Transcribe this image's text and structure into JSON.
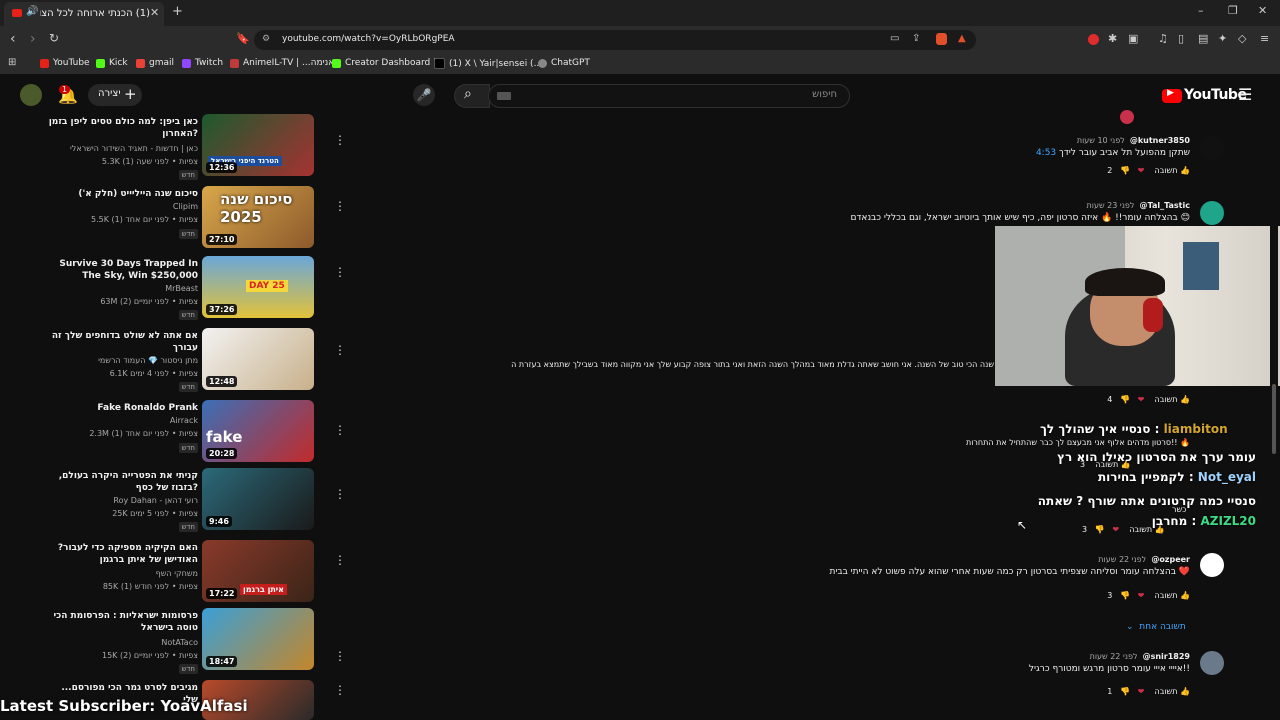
{
  "browser": {
    "tab_title": "(1) הכנתי ארוחה לכל הצופים",
    "url": "youtube.com/watch?v=OyRLbORgPEA",
    "bookmarks": [
      "YouTube",
      "Kick",
      "gmail",
      "Twitch",
      "AnimeIL-TV | ...אנימה",
      "Creator Dashboard |...",
      "(1) X \\ Yair|sensei (...",
      "ChatGPT"
    ]
  },
  "youtube": {
    "logo": "YouTube",
    "search_placeholder": "חיפוש",
    "create_label": "יצירה",
    "notif_count": "1"
  },
  "videos": [
    {
      "title": "כאן ביפן: למה כולם טסים ליפן בזמן האחרון?",
      "channel": "כאן | חדשות - תאגיד השידור הישראלי",
      "meta": "5.3K צפיות • לפני שעה (1)",
      "badge": "חדש",
      "duration": "12:36",
      "thumb_text": "הטרנד היפני בישראל"
    },
    {
      "title": "סיכום שנה הייליייט (חלק א')",
      "channel": "Clipim",
      "meta": "5.5K צפיות • לפני יום אחד (1)",
      "badge": "חדש",
      "duration": "27:10",
      "thumb_text": "סיכום שנה 2025"
    },
    {
      "title": "Survive 30 Days Trapped In The Sky, Win $250,000",
      "channel": "MrBeast",
      "meta": "63M צפיות • לפני יומיים (2)",
      "badge": "חדש",
      "duration": "37:26",
      "thumb_text": "DAY 25"
    },
    {
      "title": "אם אתה לא שולט בדוחפים שלך זה עבורך",
      "channel": "מתן ניסטור 💎 העמוד הרשמי",
      "meta": "6.1K צפיות • לפני 4 ימים",
      "badge": "חדש",
      "duration": "12:48",
      "thumb_text": ""
    },
    {
      "title": "Fake Ronaldo Prank",
      "channel": "Airrack",
      "meta": "2.3M צפיות • לפני יום אחד (1)",
      "badge": "חדש",
      "duration": "20:28",
      "thumb_text": "fake"
    },
    {
      "title": "קניתי את הפטרייה היקרה בעולם, בזבוז של כסף?",
      "channel": "Roy Dahan - רועי דהאן",
      "meta": "25K צפיות • לפני 5 ימים",
      "badge": "חדש",
      "duration": "9:46",
      "thumb_text": ""
    },
    {
      "title": "האם הקיקיה מספיקה כדי לעבור? האודישן של איתן ברגמן",
      "channel": "משחקי השף",
      "meta": "85K צפיות • לפני חודש (1)",
      "badge": "",
      "duration": "17:22",
      "thumb_text": "איתן ברגמן"
    },
    {
      "title": "פרסומות ישראליות : הפרסומת הכי טוסה בישראל",
      "channel": "NotATaco",
      "meta": "15K צפיות • לפני יומיים (2)",
      "badge": "חדש",
      "duration": "18:47",
      "thumb_text": ""
    },
    {
      "title": "...מגיבים לסרט גמר הכי מפורסם שלי",
      "channel": "",
      "meta": "",
      "badge": "",
      "duration": "",
      "thumb_text": ""
    }
  ],
  "comments": [
    {
      "user": "@kutner3850",
      "time": "לפני 10 שעות",
      "text": "שתקן מהפועל תל אביב עובר לידך",
      "timestamp": "4:53",
      "likes": "2",
      "reply": "תשובה"
    },
    {
      "user": "@Tal_Tastic",
      "time": "לפני 23 שעות",
      "text": "בהצלחה עומר!! 🔥 איזה סרטון יפה, כיף שיש אותך ביוטיוב ישראל, וגם בכללי כבנאדם 😊",
      "likes": "4",
      "reply": "תשובה"
    },
    {
      "user": "",
      "time": "",
      "text": "שנה הכי טוב של השנה. אני חושב שאתה גדלת מאוד במהלך השנה הזאת ואני בתור צופה קבוע שלך אני מקווה מאוד בשבילך שתמצא בעזרת ה",
      "likes": "",
      "reply": ""
    },
    {
      "user": "",
      "time": "",
      "text": "סרטון מדהים אלוף אני מבעצם לך כבר שהתחיל את התחרות!! 🔥",
      "likes": "3",
      "reply": "תשובה"
    },
    {
      "user": "",
      "time": "",
      "text": "כשר",
      "likes": "3",
      "reply": "תשובה"
    },
    {
      "user": "@ozpeer",
      "time": "לפני 22 שעות",
      "text": "בהצלחה עומר וסליחה שצפיתי בסרטון רק כמה שעות אחרי שהוא עלה פשוט לא הייתי בבית ❤️",
      "likes": "3",
      "reply": "תשובה",
      "more_replies": "תשובה אחת"
    },
    {
      "user": "@snir1829",
      "time": "לפני 22 שעות",
      "text": "איייי אייי עומר סרטון מרגש ומטורף כרגיל!!",
      "likes": "1",
      "reply": "תשובה"
    }
  ],
  "stream_chat": [
    {
      "user": "liambiton",
      "text": "סנסיי איך שהולך לך",
      "color": "#d4a72c"
    },
    {
      "user": "Not_eyal",
      "text": "עומר ערך את הסרטון כאילו הוא רץ לקמפיין בחירות",
      "color": "#9fd3ff"
    },
    {
      "user": "AZIZL20",
      "text": "סנסיי כמה קרטונים אתה שורף ? שאתה מחרבן",
      "color": "#3ddc84"
    }
  ],
  "overlay": {
    "latest_subscriber": "Latest Subscriber: YoavAlfasi"
  }
}
